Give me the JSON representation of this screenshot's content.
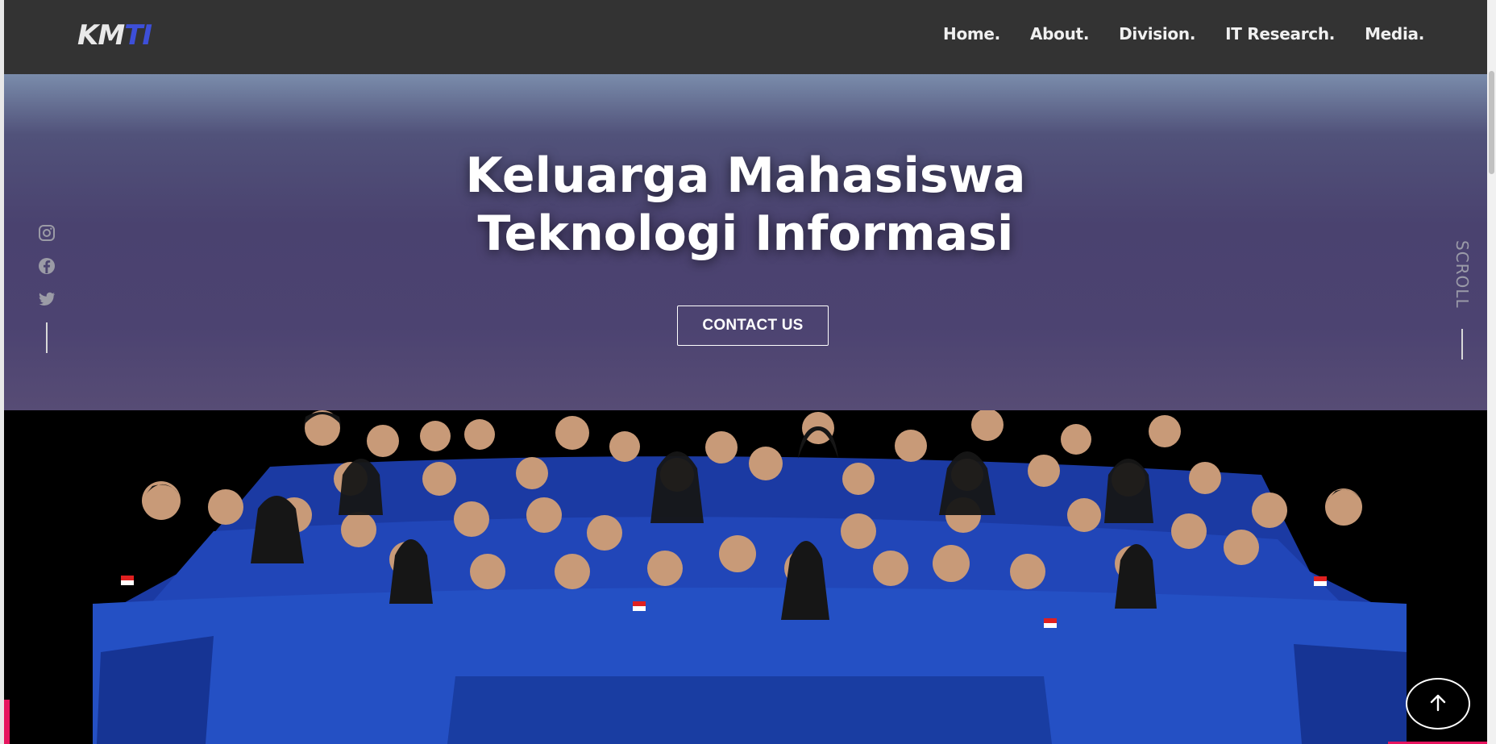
{
  "navbar": {
    "logo_km": "KM",
    "logo_ti": "TI",
    "menu": [
      "Home.",
      "About.",
      "Division.",
      "IT Research.",
      "Media."
    ]
  },
  "hero": {
    "title_line1": "Keluarga Mahasiswa",
    "title_line2": "Teknologi Informasi",
    "contact_button": "CONTACT US"
  },
  "social": {
    "icons": [
      "instagram-icon",
      "facebook-icon",
      "twitter-icon"
    ]
  },
  "scroll_label": "SCROLL",
  "colors": {
    "navbar_bg": "#333333",
    "logo_accent": "#3d4fd8",
    "hero_top": "#7a8cab",
    "hero_mid": "#4a426f",
    "accent_pink": "#e6155e",
    "uniform_blue": "#1f43b4"
  }
}
